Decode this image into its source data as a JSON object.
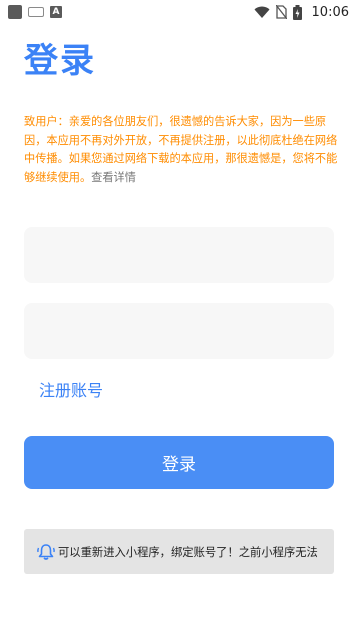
{
  "status_bar": {
    "time": "10:06",
    "icons": [
      "app-square-icon",
      "keyboard-icon",
      "a-app-icon",
      "wifi-icon",
      "sim-off-icon",
      "battery-charging-icon"
    ]
  },
  "page": {
    "title": "登录",
    "notice_text": "致用户：亲爱的各位朋友们，很遗憾的告诉大家，因为一些原因，本应用不再对外开放，不再提供注册，以此彻底杜绝在网络中传播。如果您通过网络下载的本应用，那很遗憾是，您将不能够继续使用。",
    "notice_link": "查看详情",
    "register_label": "注册账号",
    "login_button_label": "登录",
    "banner_text": "可以重新进入小程序，绑定账号了！之前小程序无法"
  },
  "colors": {
    "accent": "#3b82f6",
    "button": "#4a8ef5",
    "notice": "#ff8c00",
    "input_bg": "#f7f7f7",
    "banner_bg": "#e4e4e4"
  }
}
